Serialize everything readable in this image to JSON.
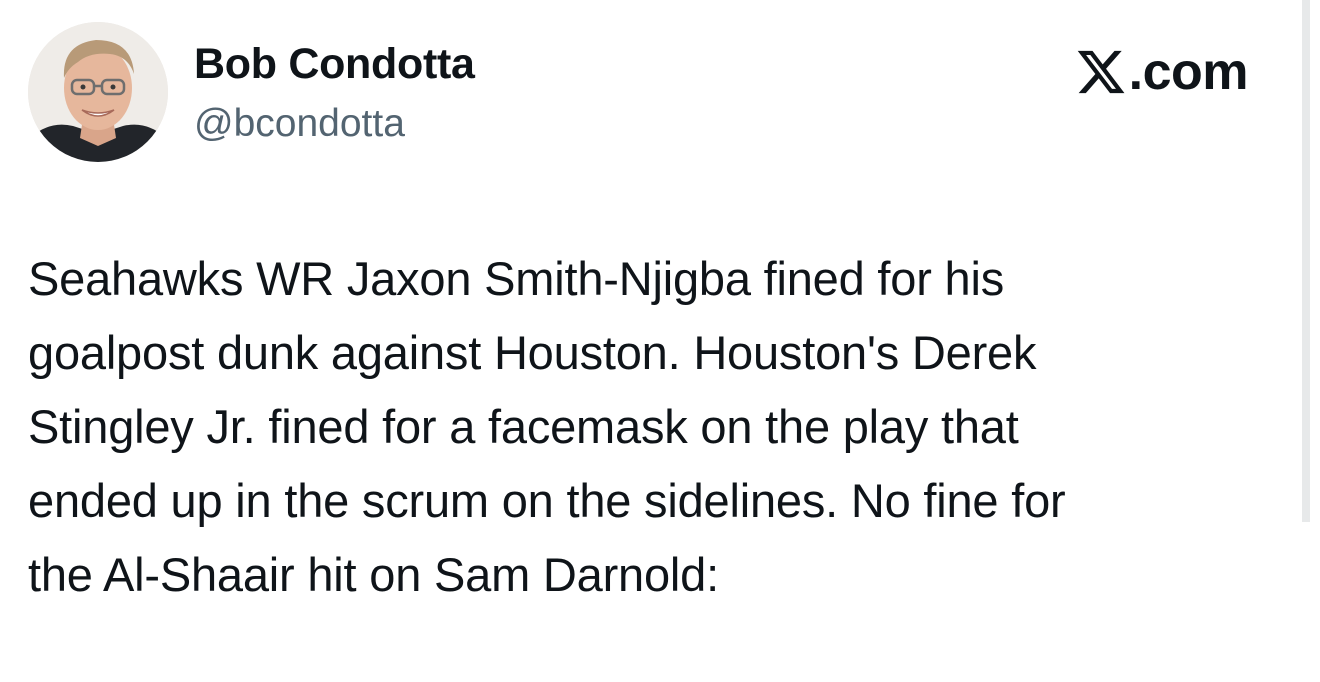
{
  "author": {
    "name": "Bob Condotta",
    "handle": "@bcondotta",
    "avatar_icon": "profile-photo"
  },
  "brand": {
    "logo_icon": "x-logo-icon",
    "text": ".com"
  },
  "tweet": {
    "lines": [
      "Seahawks WR Jaxon Smith-Njigba fined for his",
      "goalpost dunk against Houston. Houston's Derek",
      "Stingley Jr. fined for a facemask on the play that",
      "ended up in the scrum on the sidelines. No fine for",
      "the Al-Shaair hit on Sam Darnold:"
    ]
  },
  "colors": {
    "text": "#0f1419",
    "secondary": "#536471",
    "background": "#ffffff"
  }
}
